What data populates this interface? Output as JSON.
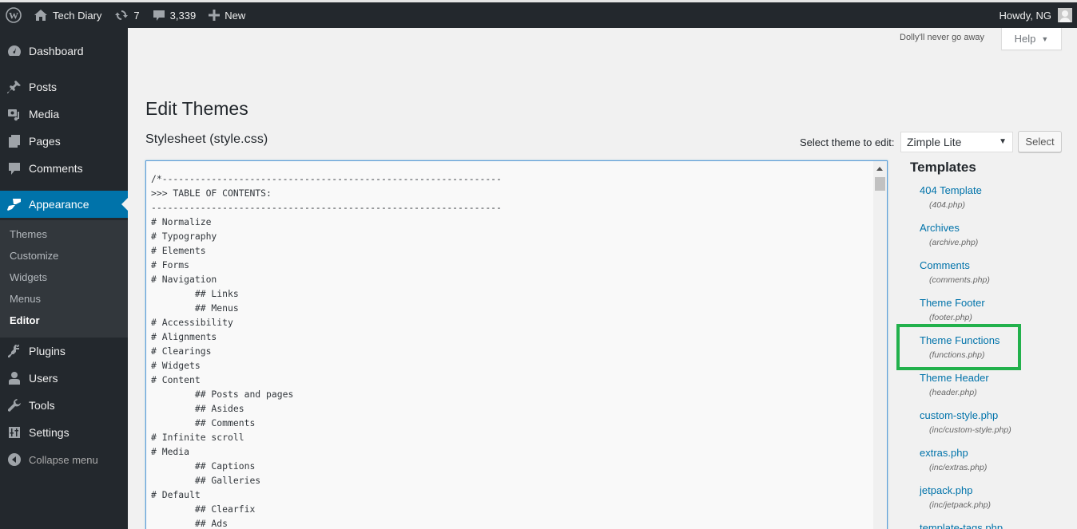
{
  "adminbar": {
    "site_name": "Tech Diary",
    "updates_count": "7",
    "comments_count": "3,339",
    "new_label": "New",
    "howdy": "Howdy, NG"
  },
  "sidebar": {
    "items": [
      {
        "label": "Dashboard",
        "icon": "dashboard-icon"
      },
      {
        "label": "Posts",
        "icon": "pin-icon"
      },
      {
        "label": "Media",
        "icon": "media-icon"
      },
      {
        "label": "Pages",
        "icon": "pages-icon"
      },
      {
        "label": "Comments",
        "icon": "comment-icon"
      },
      {
        "label": "Appearance",
        "icon": "paintbrush-icon",
        "current": true
      },
      {
        "label": "Plugins",
        "icon": "plug-icon"
      },
      {
        "label": "Users",
        "icon": "user-icon"
      },
      {
        "label": "Tools",
        "icon": "wrench-icon"
      },
      {
        "label": "Settings",
        "icon": "settings-icon"
      }
    ],
    "submenu": [
      "Themes",
      "Customize",
      "Widgets",
      "Menus",
      "Editor"
    ],
    "submenu_current": "Editor",
    "collapse_label": "Collapse menu"
  },
  "header": {
    "dolly": "Dolly'll never go away",
    "help_label": "Help"
  },
  "main": {
    "title": "Edit Themes",
    "file_title": "Stylesheet (style.css)",
    "theme_select_label": "Select theme to edit:",
    "theme_selected": "Zimple Lite",
    "select_button": "Select"
  },
  "editor": {
    "lines": [
      "/*--------------------------------------------------------------",
      ">>> TABLE OF CONTENTS:",
      "----------------------------------------------------------------",
      "# Normalize",
      "# Typography",
      "# Elements",
      "# Forms",
      "# Navigation",
      "\t## Links",
      "\t## Menus",
      "# Accessibility",
      "# Alignments",
      "# Clearings",
      "# Widgets",
      "# Content",
      "\t## Posts and pages",
      "\t## Asides",
      "\t## Comments",
      "# Infinite scroll",
      "# Media",
      "\t## Captions",
      "\t## Galleries",
      "# Default",
      "\t## Clearfix",
      "\t## Ads"
    ]
  },
  "templates": {
    "heading": "Templates",
    "items": [
      {
        "name": "404 Template",
        "file": "(404.php)"
      },
      {
        "name": "Archives",
        "file": "(archive.php)"
      },
      {
        "name": "Comments",
        "file": "(comments.php)"
      },
      {
        "name": "Theme Footer",
        "file": "(footer.php)"
      },
      {
        "name": "Theme Functions",
        "file": "(functions.php)",
        "highlighted": true
      },
      {
        "name": "Theme Header",
        "file": "(header.php)"
      },
      {
        "name": "custom-style.php",
        "file": "(inc/custom-style.php)"
      },
      {
        "name": "extras.php",
        "file": "(inc/extras.php)"
      },
      {
        "name": "jetpack.php",
        "file": "(inc/jetpack.php)"
      },
      {
        "name": "template-tags.php",
        "file": ""
      }
    ]
  },
  "colors": {
    "adminbar_bg": "#23282d",
    "accent": "#0073aa",
    "highlight_box": "#22b14c"
  }
}
